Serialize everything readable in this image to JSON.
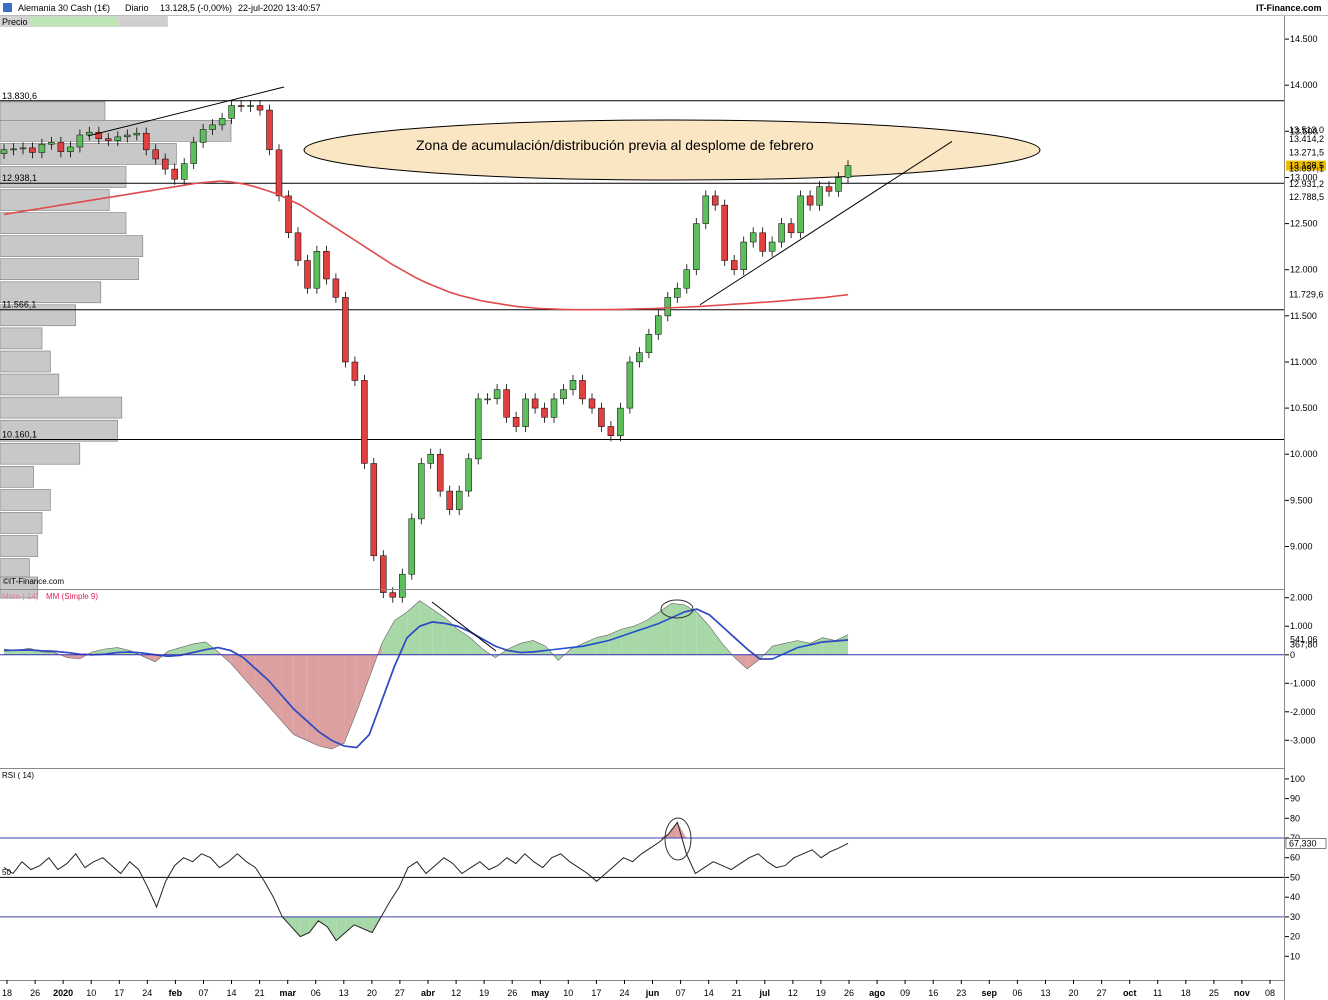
{
  "header": {
    "instrument": "Alemania 30 Cash (1€)",
    "period": "Diario",
    "price_change": "13.128,5 (-0,00%)",
    "datetime": "22-jul-2020 13:40:57",
    "brand": "IT-Finance.com",
    "tab_label": "Precio"
  },
  "watermark": "©IT-Finance.com",
  "chart_data": [
    {
      "type": "line",
      "panel": "price",
      "yticks": [
        "14.500",
        "14.000",
        "13.500",
        "13.000",
        "12.500",
        "12.000",
        "11.500",
        "11.000",
        "10.500",
        "10.000",
        "9.500",
        "9.000"
      ],
      "ylim": [
        8550,
        14750
      ],
      "levels": [
        {
          "label": "13.830,6",
          "value": 13830.6
        },
        {
          "label": "12.938,1",
          "value": 12938.1
        },
        {
          "label": "11.566,1",
          "value": 11566.1
        },
        {
          "label": "10.160,1",
          "value": 10160.1
        }
      ],
      "annotation": "Zona de acumulación/distribución previa al desplome de febrero",
      "price_tags": [
        {
          "label": "13.513,0",
          "color": "#e02020"
        },
        {
          "label": "13.414,2",
          "color": "#e02020"
        },
        {
          "label": "13.271,5",
          "color": "#e02020"
        },
        {
          "label": "13.128,5",
          "color": "#000000",
          "bg": "#f0c000"
        },
        {
          "label": "13.097,1",
          "color": "#2a8a2a"
        },
        {
          "label": "12.931,2",
          "color": "#2a8a2a"
        },
        {
          "label": "12.788,5",
          "color": "#2a8a2a"
        },
        {
          "label": "11.729,6",
          "color": "#2a8a2a"
        }
      ],
      "close_series": [
        13300,
        13310,
        13320,
        13270,
        13360,
        13380,
        13280,
        13330,
        13460,
        13490,
        13420,
        13400,
        13440,
        13460,
        13480,
        13300,
        13200,
        13090,
        12980,
        13150,
        13380,
        13520,
        13570,
        13640,
        13780,
        13770,
        13780,
        13730,
        13300,
        12800,
        12400,
        12100,
        11800,
        12200,
        11900,
        11700,
        11000,
        10800,
        9900,
        8900,
        8500,
        8450,
        8700,
        9300,
        9900,
        10000,
        9600,
        9400,
        9600,
        9950,
        10600,
        10600,
        10700,
        10400,
        10300,
        10600,
        10500,
        10400,
        10600,
        10700,
        10800,
        10600,
        10500,
        10300,
        10200,
        10500,
        11000,
        11100,
        11300,
        11500,
        11700,
        11800,
        12000,
        12500,
        12800,
        12700,
        12100,
        12000,
        12300,
        12400,
        12200,
        12300,
        12500,
        12400,
        12800,
        12700,
        12900,
        12850,
        13000,
        13128
      ],
      "ema200_series": [
        12600,
        12620,
        12640,
        12660,
        12680,
        12700,
        12720,
        12740,
        12760,
        12780,
        12800,
        12820,
        12840,
        12860,
        12880,
        12900,
        12920,
        12940,
        12950,
        12960,
        12950,
        12930,
        12900,
        12860,
        12820,
        12760,
        12700,
        12620,
        12540,
        12460,
        12380,
        12300,
        12220,
        12140,
        12060,
        11990,
        11920,
        11860,
        11810,
        11760,
        11720,
        11690,
        11660,
        11640,
        11620,
        11600,
        11590,
        11580,
        11575,
        11570,
        11566,
        11566,
        11567,
        11568,
        11570,
        11573,
        11576,
        11580,
        11585,
        11590,
        11596,
        11602,
        11610,
        11618,
        11626,
        11634,
        11642,
        11650,
        11660,
        11670,
        11680,
        11690,
        11700,
        11715,
        11729
      ],
      "volume_profile": [
        {
          "price": 13700,
          "width": 0.25
        },
        {
          "price": 13500,
          "width": 0.55
        },
        {
          "price": 13250,
          "width": 0.42
        },
        {
          "price": 13000,
          "width": 0.3
        },
        {
          "price": 12750,
          "width": 0.26
        },
        {
          "price": 12500,
          "width": 0.3
        },
        {
          "price": 12250,
          "width": 0.34
        },
        {
          "price": 12000,
          "width": 0.33
        },
        {
          "price": 11750,
          "width": 0.24
        },
        {
          "price": 11500,
          "width": 0.18
        },
        {
          "price": 11250,
          "width": 0.1
        },
        {
          "price": 11000,
          "width": 0.12
        },
        {
          "price": 10750,
          "width": 0.14
        },
        {
          "price": 10500,
          "width": 0.29
        },
        {
          "price": 10250,
          "width": 0.28
        },
        {
          "price": 10000,
          "width": 0.19
        },
        {
          "price": 9750,
          "width": 0.08
        },
        {
          "price": 9500,
          "width": 0.12
        },
        {
          "price": 9250,
          "width": 0.1
        },
        {
          "price": 9000,
          "width": 0.09
        },
        {
          "price": 8750,
          "width": 0.07
        },
        {
          "price": 8550,
          "width": 0.09
        }
      ]
    },
    {
      "type": "line",
      "panel": "momentum",
      "legend": "Mom ( 14)",
      "ma_legend": "MM (Simple 9)",
      "yticks": [
        "2.000",
        "1.000",
        "0",
        "-1.000",
        "-2.000",
        "-3.000"
      ],
      "ylim": [
        -3900,
        2200
      ],
      "tags": [
        {
          "label": "541,06",
          "color": "#e02020"
        },
        {
          "label": "367,80",
          "color": "#e02020"
        }
      ],
      "mom_series": [
        200,
        150,
        230,
        100,
        80,
        -100,
        -150,
        100,
        200,
        250,
        150,
        -50,
        -250,
        120,
        250,
        380,
        450,
        100,
        -300,
        -800,
        -1300,
        -1800,
        -2300,
        -2800,
        -3000,
        -3200,
        -3300,
        -3100,
        -2000,
        -800,
        400,
        1200,
        1500,
        1900,
        1600,
        1300,
        900,
        600,
        200,
        -100,
        200,
        400,
        500,
        300,
        -200,
        200,
        400,
        600,
        700,
        900,
        1000,
        1200,
        1500,
        1800,
        1750,
        1500,
        1000,
        400,
        -100,
        -500,
        -150,
        300,
        400,
        500,
        400,
        600,
        500,
        700
      ],
      "ma_series": [
        150,
        160,
        170,
        140,
        120,
        80,
        20,
        0,
        20,
        80,
        100,
        60,
        0,
        -50,
        -20,
        80,
        180,
        250,
        150,
        -100,
        -500,
        -900,
        -1400,
        -1900,
        -2300,
        -2700,
        -3000,
        -3200,
        -3250,
        -2800,
        -1600,
        -400,
        600,
        1000,
        1150,
        1100,
        1000,
        800,
        550,
        300,
        150,
        80,
        100,
        150,
        200,
        250,
        300,
        400,
        500,
        650,
        800,
        950,
        1100,
        1300,
        1500,
        1600,
        1400,
        1000,
        600,
        200,
        -150,
        -150,
        50,
        250,
        350,
        450,
        480,
        520
      ]
    },
    {
      "type": "line",
      "panel": "rsi",
      "legend": "RSI ( 14)",
      "yticks": [
        "100",
        "90",
        "80",
        "70",
        "60",
        "50",
        "40",
        "30",
        "20",
        "10"
      ],
      "ylim": [
        0,
        104
      ],
      "tag": "67,330",
      "left_label": "50",
      "levels": [
        70,
        50,
        30
      ],
      "rsi_series": [
        55,
        52,
        58,
        54,
        56,
        60,
        54,
        57,
        62,
        55,
        58,
        60,
        56,
        52,
        58,
        54,
        45,
        35,
        48,
        56,
        60,
        58,
        62,
        60,
        55,
        58,
        62,
        58,
        55,
        48,
        40,
        30,
        25,
        20,
        22,
        28,
        25,
        18,
        22,
        26,
        24,
        22,
        30,
        38,
        45,
        55,
        58,
        52,
        56,
        60,
        57,
        52,
        55,
        58,
        54,
        56,
        60,
        57,
        62,
        58,
        55,
        60,
        62,
        58,
        55,
        52,
        48,
        52,
        56,
        60,
        58,
        62,
        65,
        68,
        72,
        78,
        62,
        52,
        55,
        58,
        56,
        54,
        57,
        60,
        62,
        58,
        55,
        56,
        60,
        62,
        64,
        60,
        63,
        65,
        67.33
      ],
      "xticks": [
        "18",
        "26",
        "2020",
        "10",
        "17",
        "24",
        "feb",
        "07",
        "14",
        "21",
        "mar",
        "06",
        "13",
        "20",
        "27",
        "abr",
        "12",
        "19",
        "26",
        "may",
        "10",
        "17",
        "24",
        "jun",
        "07",
        "14",
        "21",
        "jul",
        "12",
        "19",
        "26",
        "ago",
        "09",
        "16",
        "23",
        "sep",
        "06",
        "13",
        "20",
        "27",
        "oct",
        "11",
        "18",
        "25",
        "nov",
        "08"
      ]
    }
  ]
}
